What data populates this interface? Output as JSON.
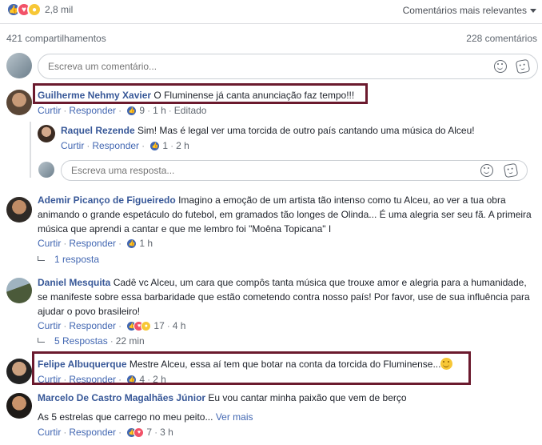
{
  "header": {
    "reaction_icons": [
      "like-icon",
      "love-icon",
      "wow-icon"
    ],
    "reaction_count": "2,8 mil",
    "sort_label": "Comentários mais relevantes"
  },
  "stats": {
    "shares": "421 compartilhamentos",
    "comments": "228 comentários"
  },
  "composer": {
    "placeholder": "Escreva um comentário..."
  },
  "reply_composer": {
    "placeholder": "Escreva uma resposta..."
  },
  "actions": {
    "like": "Curtir",
    "reply": "Responder"
  },
  "comments": [
    {
      "author": "Guilherme Nehmy Xavier",
      "text": "O Fluminense já canta anunciação faz tempo!!!",
      "reaction_count": "9",
      "time": "1 h",
      "edited": "Editado"
    },
    {
      "author": "Raquel Rezende",
      "text": "Sim! Mas é legal ver uma torcida de outro país cantando uma música do Alceu!",
      "reaction_count": "1",
      "time": "2 h"
    },
    {
      "author": "Ademir Picanço de Figueiredo",
      "text": "Imagino a emoção de um artista tão intenso como tu Alceu, ao ver a tua obra animando o grande espetáculo do futebol, em gramados tão longes de Olinda... É uma alegria ser seu fã. A primeira música que aprendi a cantar e que me lembro foi \"Moêna Topicana\" I",
      "reaction_count": "",
      "time": "1 h",
      "replies": "1 resposta"
    },
    {
      "author": "Daniel Mesquita",
      "text": "Cadê vc Alceu, um cara que compôs tanta música que trouxe amor e alegria para a humanidade, se manifeste sobre essa barbaridade que estão cometendo contra nosso país! Por favor, use de sua influência para ajudar o povo brasileiro!",
      "reaction_count": "17",
      "time": "4 h",
      "replies": "5 Respostas",
      "replies_time": "22 min"
    },
    {
      "author": "Felipe Albuquerque",
      "text": "Mestre Alceu, essa aí tem que botar na conta da torcida do Fluminense...",
      "reaction_count": "4",
      "time": "2 h"
    },
    {
      "author": "Marcelo De Castro Magalhães Júnior",
      "text": "Eu vou cantar minha paixão que vem de berço",
      "text2": "As 5 estrelas que carrego no meu peito...",
      "more": "Ver mais",
      "reaction_count": "7",
      "time": "3 h"
    }
  ],
  "colors": {
    "link": "#385898",
    "action": "#4267b2",
    "highlight_border": "#6b1a2e"
  }
}
